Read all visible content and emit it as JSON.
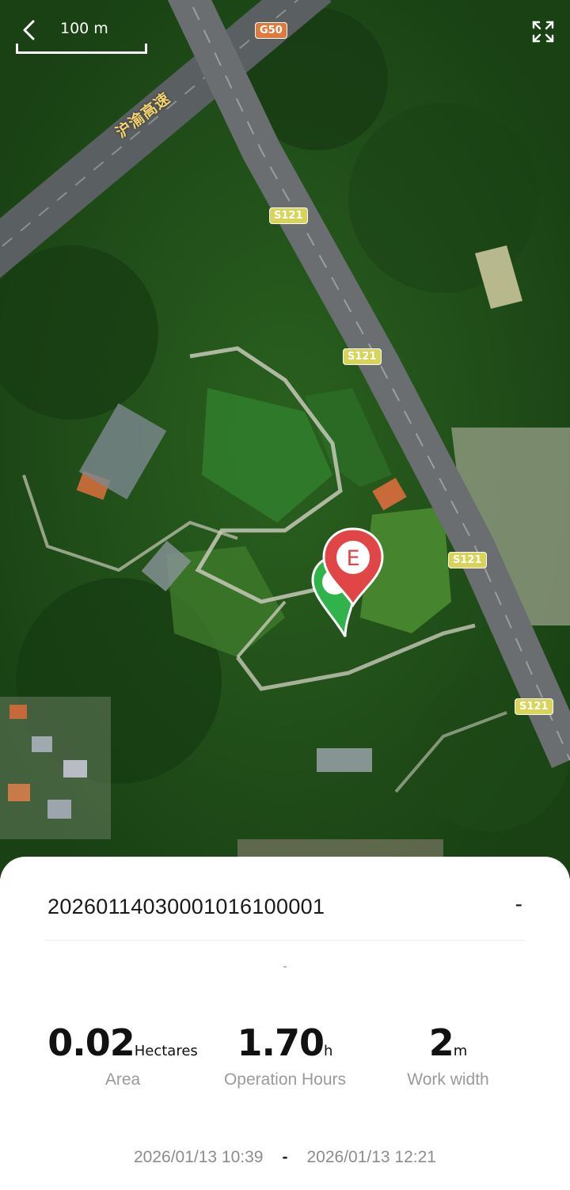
{
  "map": {
    "scale_label": "100 m",
    "road_badges": [
      {
        "label": "G50",
        "kind": "expressway"
      },
      {
        "label": "S121",
        "kind": "provincial"
      },
      {
        "label": "S121",
        "kind": "provincial"
      },
      {
        "label": "S121",
        "kind": "provincial"
      },
      {
        "label": "S121",
        "kind": "provincial"
      }
    ],
    "road_name": "沪渝高速",
    "end_marker_label": "E",
    "icons": [
      "back-icon",
      "fullscreen-icon",
      "start-pin-icon",
      "end-pin-icon"
    ]
  },
  "record": {
    "id": "20260114030001016100001",
    "status": "-",
    "subtitle": "-"
  },
  "stats": [
    {
      "value": "0.02",
      "unit": "Hectares",
      "label": "Area"
    },
    {
      "value": "1.70",
      "unit": "h",
      "label": "Operation Hours"
    },
    {
      "value": "2",
      "unit": "m",
      "label": "Work width"
    }
  ],
  "time_range": {
    "start": "2026/01/13 10:39",
    "separator": "-",
    "end": "2026/01/13 12:21"
  },
  "colors": {
    "start_pin": "#2fb34a",
    "end_pin": "#e04646",
    "expressway_badge": "#e07a3c",
    "provincial_badge": "#d8d45a"
  }
}
